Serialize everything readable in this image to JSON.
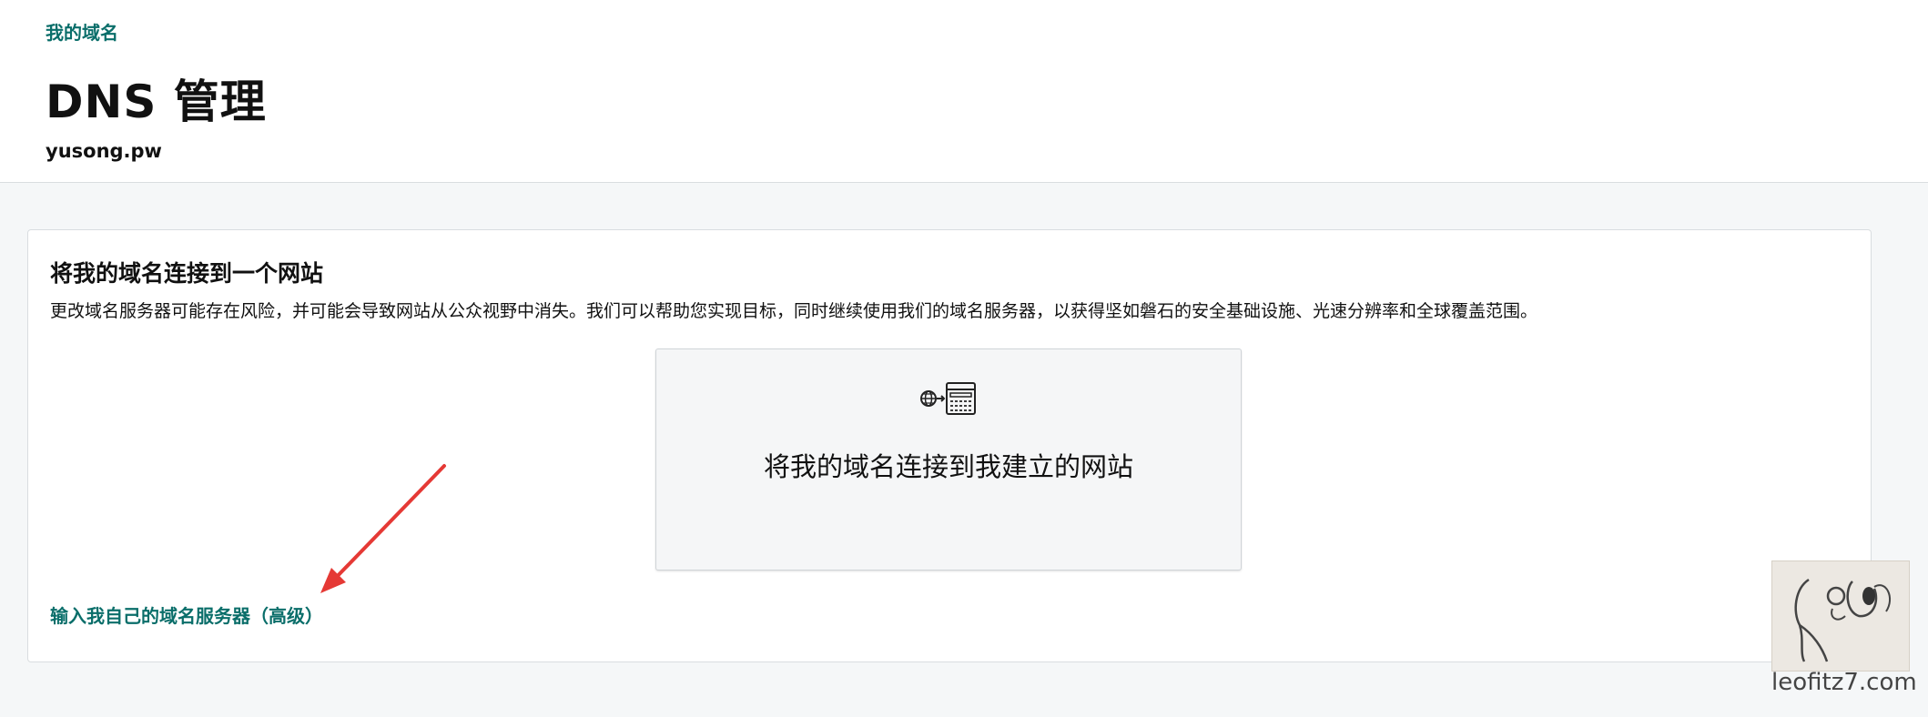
{
  "header": {
    "breadcrumb": "我的域名",
    "title": "DNS 管理",
    "domain": "yusong.pw"
  },
  "card": {
    "title": "将我的域名连接到一个网站",
    "description": "更改域名服务器可能存在风险，并可能会导致网站从公众视野中消失。我们可以帮助您实现目标，同时继续使用我们的域名服务器，以获得坚如磐石的安全基础设施、光速分辨率和全球覆盖范围。",
    "option": {
      "label": "将我的域名连接到我建立的网站",
      "icon": "globe-website-icon"
    },
    "advanced_link": "输入我自己的域名服务器（高级）"
  },
  "annotation": {
    "arrow_color": "#e53935",
    "icon": "red-arrow-icon"
  },
  "watermark": {
    "text": "leofitz7.com",
    "icon": "dog-sketch-logo"
  },
  "colors": {
    "accent": "#0a6e6a",
    "page_bg": "#f5f7f8",
    "card_bg": "#ffffff",
    "tile_bg": "#f5f6f7"
  }
}
